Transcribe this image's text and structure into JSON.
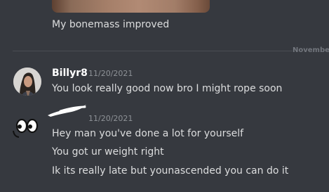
{
  "previous_message": {
    "text": "My bonemass improved"
  },
  "divider": {
    "label": "November"
  },
  "messages": [
    {
      "username": "Billyr8",
      "timestamp": "11/20/2021",
      "lines": [
        "You look really good now bro I might rope soon"
      ]
    },
    {
      "username": "",
      "timestamp": "11/20/2021",
      "lines": [
        "Hey man you've done a lot for yourself",
        "You got ur weight right",
        "Ik its really late but younascended you can do it"
      ]
    }
  ]
}
